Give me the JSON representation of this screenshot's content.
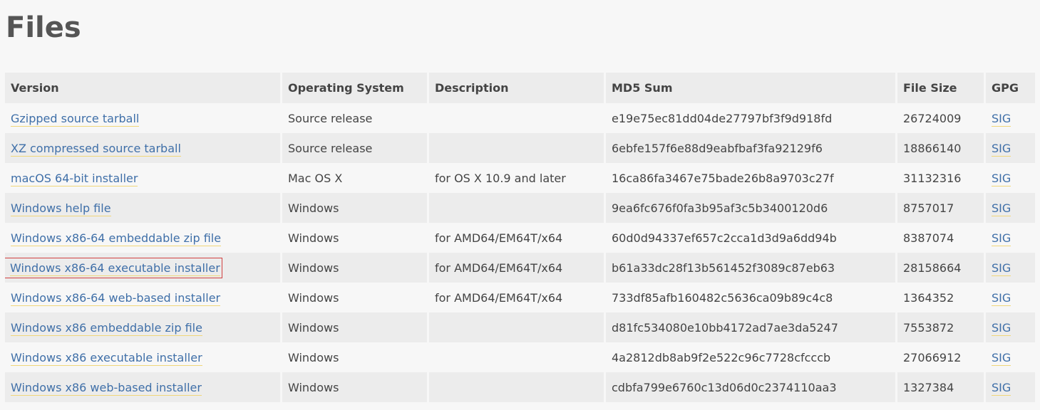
{
  "heading": "Files",
  "columns": {
    "version": "Version",
    "os": "Operating System",
    "description": "Description",
    "md5": "MD5 Sum",
    "size": "File Size",
    "gpg": "GPG"
  },
  "rows": [
    {
      "version": "Gzipped source tarball",
      "os": "Source release",
      "description": "",
      "md5": "e19e75ec81dd04de27797bf3f9d918fd",
      "size": "26724009",
      "gpg": "SIG"
    },
    {
      "version": "XZ compressed source tarball",
      "os": "Source release",
      "description": "",
      "md5": "6ebfe157f6e88d9eabfbaf3fa92129f6",
      "size": "18866140",
      "gpg": "SIG"
    },
    {
      "version": "macOS 64-bit installer",
      "os": "Mac OS X",
      "description": "for OS X 10.9 and later",
      "md5": "16ca86fa3467e75bade26b8a9703c27f",
      "size": "31132316",
      "gpg": "SIG"
    },
    {
      "version": "Windows help file",
      "os": "Windows",
      "description": "",
      "md5": "9ea6fc676f0fa3b95af3c5b3400120d6",
      "size": "8757017",
      "gpg": "SIG"
    },
    {
      "version": "Windows x86-64 embeddable zip file",
      "os": "Windows",
      "description": "for AMD64/EM64T/x64",
      "md5": "60d0d94337ef657c2cca1d3d9a6dd94b",
      "size": "8387074",
      "gpg": "SIG"
    },
    {
      "version": "Windows x86-64 executable installer",
      "os": "Windows",
      "description": "for AMD64/EM64T/x64",
      "md5": "b61a33dc28f13b561452f3089c87eb63",
      "size": "28158664",
      "gpg": "SIG",
      "highlighted": true
    },
    {
      "version": "Windows x86-64 web-based installer",
      "os": "Windows",
      "description": "for AMD64/EM64T/x64",
      "md5": "733df85afb160482c5636ca09b89c4c8",
      "size": "1364352",
      "gpg": "SIG"
    },
    {
      "version": "Windows x86 embeddable zip file",
      "os": "Windows",
      "description": "",
      "md5": "d81fc534080e10bb4172ad7ae3da5247",
      "size": "7553872",
      "gpg": "SIG"
    },
    {
      "version": "Windows x86 executable installer",
      "os": "Windows",
      "description": "",
      "md5": "4a2812db8ab9f2e522c96c7728cfcccb",
      "size": "27066912",
      "gpg": "SIG"
    },
    {
      "version": "Windows x86 web-based installer",
      "os": "Windows",
      "description": "",
      "md5": "cdbfa799e6760c13d06d0c2374110aa3",
      "size": "1327384",
      "gpg": "SIG"
    }
  ],
  "colors": {
    "link": "#3f6fa8",
    "link_underline": "#f0d67a",
    "highlight_border": "#d04040",
    "header_bg": "#ececec",
    "row_alt_bg": "#ececec",
    "page_bg": "#f7f7f7"
  }
}
